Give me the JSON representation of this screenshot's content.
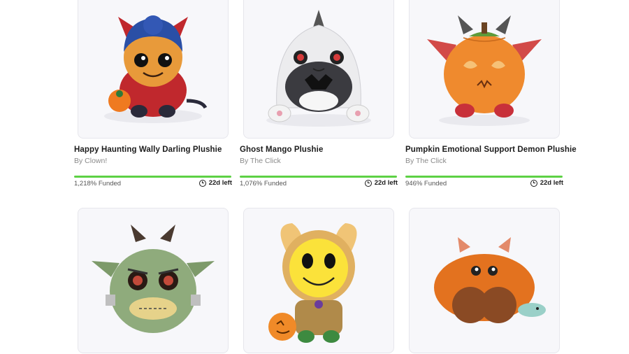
{
  "products": [
    {
      "name": "Happy Haunting Wally Darling Plushie",
      "creator": "By Clown!",
      "funded": "1,218% Funded",
      "funded_pct": 1218,
      "time_left": "22d left",
      "icon": "red-devil-costume-plush-icon"
    },
    {
      "name": "Ghost Mango Plushie",
      "creator": "By The Click",
      "funded": "1,076% Funded",
      "funded_pct": 1076,
      "time_left": "22d left",
      "icon": "ghost-hood-plush-icon"
    },
    {
      "name": "Pumpkin Emotional Support Demon Plushie",
      "creator": "By The Click",
      "funded": "946% Funded",
      "funded_pct": 946,
      "time_left": "22d left",
      "icon": "pumpkin-demon-plush-icon"
    },
    {
      "name": "",
      "creator": "",
      "funded": "",
      "time_left": "",
      "icon": "green-monster-plush-icon"
    },
    {
      "name": "",
      "creator": "",
      "funded": "",
      "time_left": "",
      "icon": "yellow-bunny-plush-icon"
    },
    {
      "name": "",
      "creator": "",
      "funded": "",
      "time_left": "",
      "icon": "orange-furry-cat-plush-icon"
    }
  ],
  "colors": {
    "progress_fill": "#5dd145",
    "card_border": "#e6e6ec",
    "card_bg": "#f7f7fa",
    "creator_text": "#8a8a8a"
  }
}
